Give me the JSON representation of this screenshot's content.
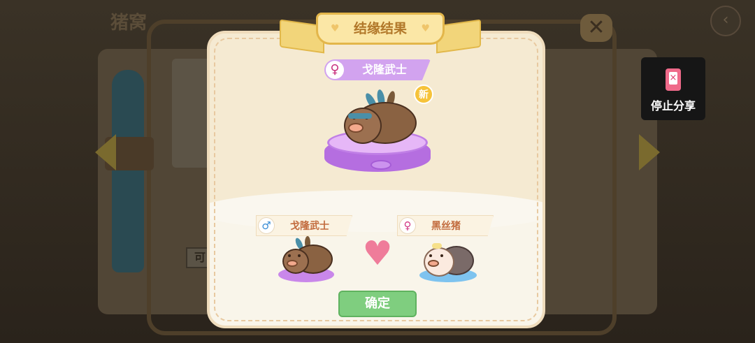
{
  "background": {
    "title": "猪窝",
    "button_text": "可"
  },
  "share": {
    "label": "停止分享",
    "icon": "phone-stop-icon"
  },
  "dialog": {
    "title": "结缘结果",
    "result": {
      "name": "戈隆武士",
      "gender": "female",
      "gender_symbol": "♀",
      "badge": "新"
    },
    "parents": [
      {
        "name": "戈隆武士",
        "gender": "male",
        "gender_symbol": "♂"
      },
      {
        "name": "黑丝猪",
        "gender": "female",
        "gender_symbol": "♀"
      }
    ],
    "confirm_label": "确定"
  },
  "colors": {
    "accent_purple": "#d2a3ef",
    "confirm_green": "#7fce7f",
    "ribbon_gold": "#fbe7a6",
    "heart_pink": "#ef7c9a",
    "name_orange": "#c26b3e"
  }
}
